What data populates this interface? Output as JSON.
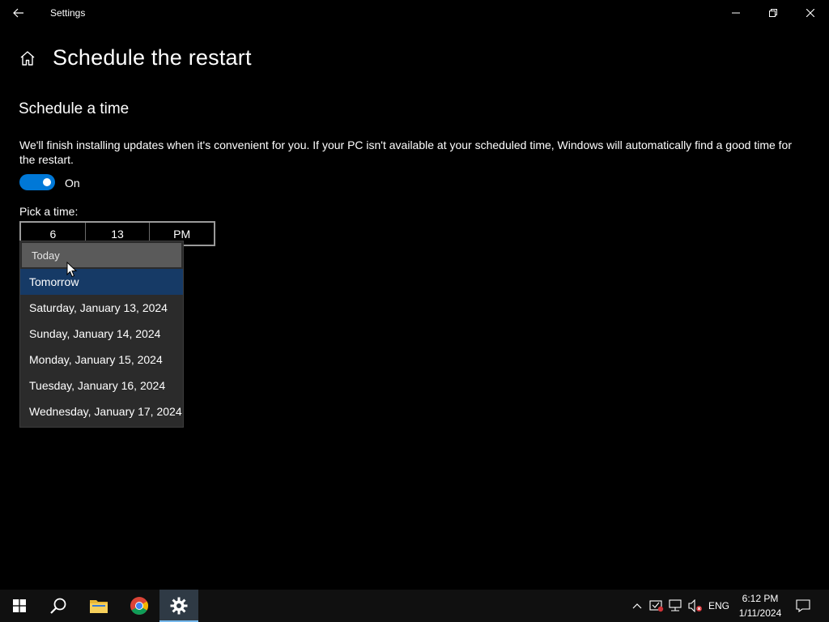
{
  "window": {
    "title": "Settings"
  },
  "page": {
    "title": "Schedule the restart",
    "section_title": "Schedule a time",
    "description": "We'll finish installing updates when it's convenient for you. If your PC isn't available at your scheduled time, Windows will automatically find a good time for the restart.",
    "toggle_state": "On",
    "pick_label": "Pick a time:"
  },
  "time_picker": {
    "hour": "6",
    "minute": "13",
    "period": "PM"
  },
  "date_dropdown": {
    "items": [
      "Today",
      "Tomorrow",
      "Saturday, January 13, 2024",
      "Sunday, January 14, 2024",
      "Monday, January 15, 2024",
      "Tuesday, January 16, 2024",
      "Wednesday, January 17, 2024"
    ],
    "hovered": "Today",
    "selected": "Tomorrow"
  },
  "taskbar": {
    "language": "ENG",
    "time": "6:12 PM",
    "date": "1/11/2024"
  },
  "colors": {
    "accent": "#0078d7",
    "selected_item": "#163a66",
    "hover_item": "#5a5a5a"
  }
}
